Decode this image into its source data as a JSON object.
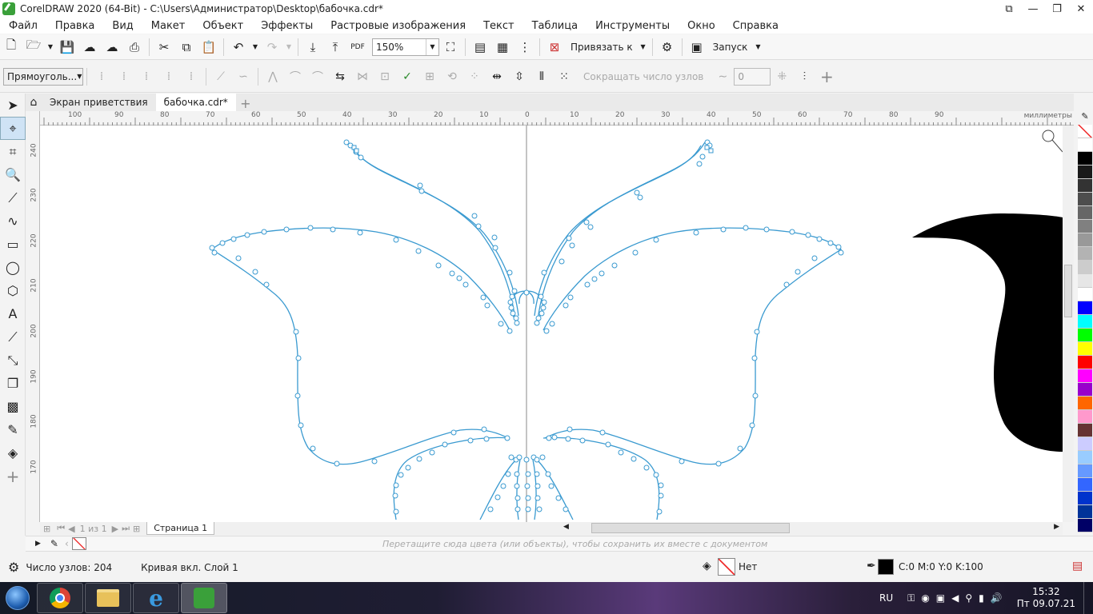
{
  "window": {
    "title": "CorelDRAW 2020 (64-Bit) - C:\\Users\\Администратор\\Desktop\\бабочка.cdr*"
  },
  "menu": [
    "Файл",
    "Правка",
    "Вид",
    "Макет",
    "Объект",
    "Эффекты",
    "Растровые изображения",
    "Текст",
    "Таблица",
    "Инструменты",
    "Окно",
    "Справка"
  ],
  "toolbar": {
    "zoom": "150%",
    "snap_label": "Привязать к",
    "launch_label": "Запуск"
  },
  "propbar": {
    "shape_mode": "Прямоуголь...",
    "reduce_nodes": "Сокращать число узлов",
    "smoothing": "0"
  },
  "tabs": {
    "welcome": "Экран приветствия",
    "document": "бабочка.cdr*"
  },
  "ruler": {
    "units": "миллиметры",
    "h_labels": [
      "100",
      "90",
      "80",
      "70",
      "60",
      "50",
      "40",
      "30",
      "20",
      "10",
      "0",
      "10",
      "20",
      "30",
      "40",
      "50",
      "60",
      "70",
      "80",
      "90"
    ],
    "v_labels": [
      "240",
      "230",
      "220",
      "210",
      "200",
      "190",
      "180",
      "170"
    ]
  },
  "pagebar": {
    "counter": "1 из 1",
    "page_name": "Страница 1"
  },
  "docpalette": {
    "hint": "Перетащите сюда цвета (или объекты), чтобы сохранить их вместе с документом"
  },
  "status": {
    "nodes": "Число узлов: 204",
    "object": "Кривая вкл. Слой 1",
    "fill": "Нет",
    "outline": "C:0 M:0 Y:0 K:100"
  },
  "palette_colors": [
    "#ffffff",
    "#000000",
    "#1a1a1a",
    "#333333",
    "#4d4d4d",
    "#666666",
    "#808080",
    "#999999",
    "#b3b3b3",
    "#cccccc",
    "#e6e6e6",
    "#ffffff",
    "#0000ff",
    "#00ffff",
    "#00ff00",
    "#ffff00",
    "#ff0000",
    "#ff00ff",
    "#9900cc",
    "#ff6600",
    "#ff99cc",
    "#663333",
    "#ccccff",
    "#99ccff",
    "#6699ff",
    "#3366ff",
    "#0033cc",
    "#003399",
    "#000066"
  ],
  "taskbar": {
    "lang": "RU",
    "time": "15:32",
    "date": "Пт 09.07.21"
  },
  "accent": "#3a9ad0"
}
